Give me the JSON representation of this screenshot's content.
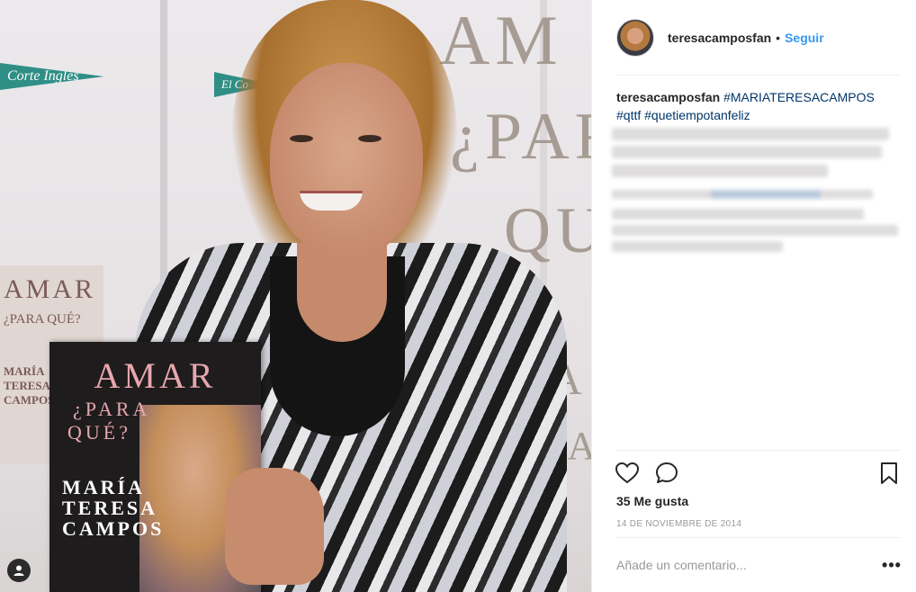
{
  "photo": {
    "banner_text_1": "AM",
    "banner_text_2": "¿PAR",
    "banner_text_3": "QUÉ",
    "banner_text_4": "ÍA",
    "banner_text_5": "SA",
    "store_logo": "Corte Inglés",
    "store_logo_2": "El Co",
    "book_title": "AMAR",
    "book_subtitle_1": "¿PARA",
    "book_subtitle_2": "QUÉ?",
    "book_author": "MARÍA TERESA CAMPOS",
    "back_book_title": "AMAR",
    "back_book_sub": "¿PARA QUÉ?",
    "back_book_author": "MARÍA TERESA CAMPOS",
    "user_tag_icon": "user-tag-icon"
  },
  "header": {
    "username": "teresacamposfan",
    "separator": "•",
    "follow_label": "Seguir"
  },
  "caption": {
    "username": "teresacamposfan",
    "tag_1": "#MARIATERESACAMPOS",
    "tag_2": "#qttf",
    "tag_3": "#quetiempotanfeliz"
  },
  "actions": {
    "like_icon": "heart-icon",
    "comment_icon": "comment-icon",
    "save_icon": "bookmark-icon"
  },
  "likes": "35 Me gusta",
  "date": "14 DE NOVIEMBRE DE 2014",
  "comment": {
    "placeholder": "Añade un comentario...",
    "more_label": "•••"
  },
  "colors": {
    "link": "#3897f0",
    "hashtag": "#003569",
    "text": "#262626",
    "muted": "#999999"
  }
}
